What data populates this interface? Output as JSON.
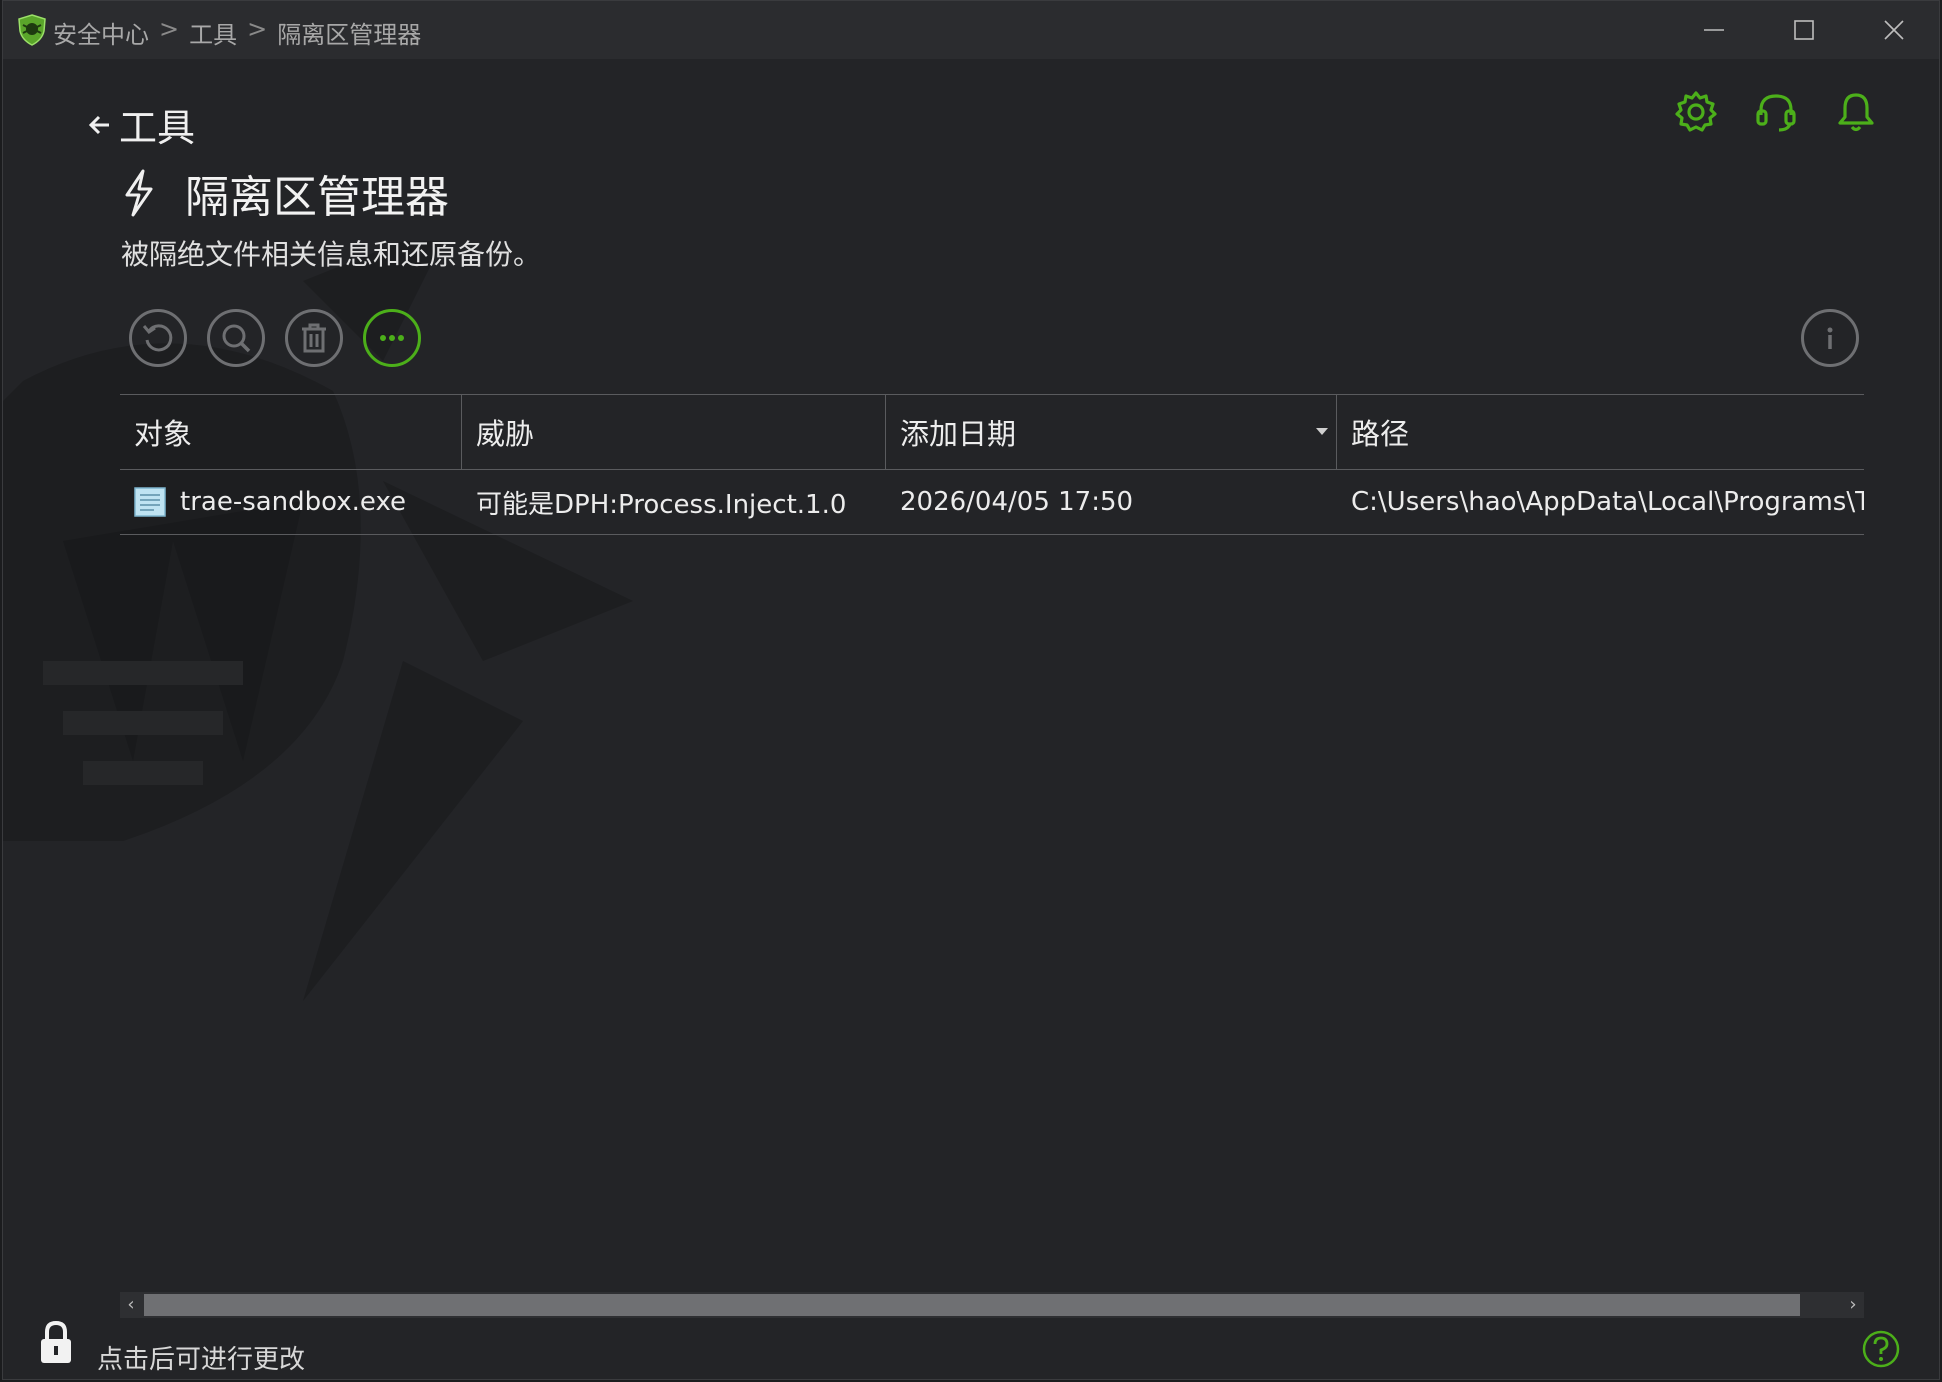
{
  "breadcrumb": {
    "items": [
      "安全中心",
      "工具",
      "隔离区管理器"
    ],
    "separator": ">"
  },
  "header": {
    "back_label": "工具",
    "title": "隔离区管理器",
    "subtitle": "被隔绝文件相关信息和还原备份。"
  },
  "toolbar": {
    "buttons": [
      "restore-icon",
      "rescan-icon",
      "delete-icon",
      "more-icon"
    ],
    "info": "info-icon"
  },
  "top_icons": [
    "gear-icon",
    "headset-icon",
    "bell-icon"
  ],
  "table": {
    "columns": [
      "对象",
      "威胁",
      "添加日期",
      "路径"
    ],
    "sorted_column": "添加日期",
    "rows": [
      {
        "object": "trae-sandbox.exe",
        "threat": "可能是DPH:Process.Inject.1.0",
        "date": "2026/04/05 17:50",
        "path": "C:\\Users\\hao\\AppData\\Local\\Programs\\Tr"
      }
    ]
  },
  "footer": {
    "lock_text": "点击后可进行更改"
  },
  "colors": {
    "accent": "#4caf1a",
    "background": "#232427",
    "titlebar": "#2b2c2f"
  }
}
